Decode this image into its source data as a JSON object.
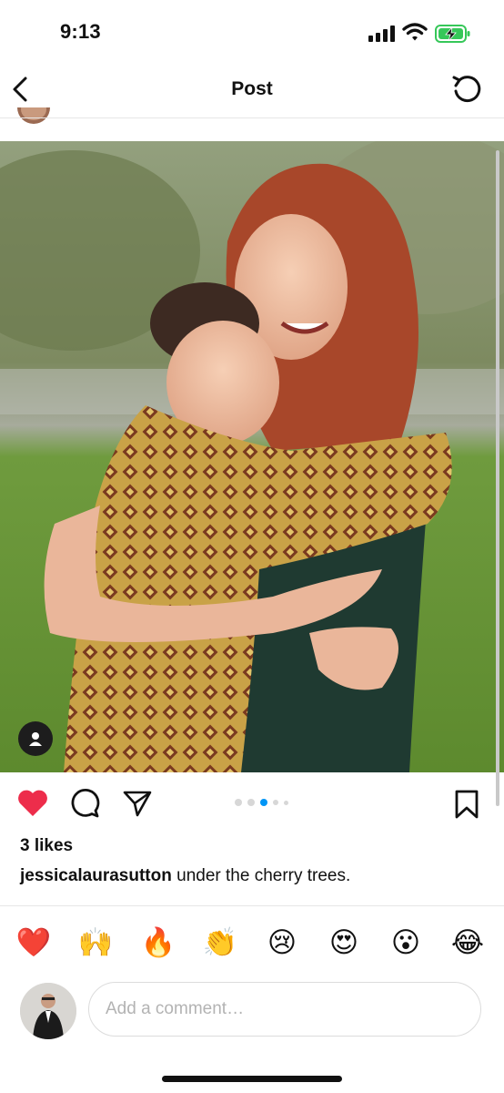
{
  "status": {
    "time": "9:13"
  },
  "header": {
    "title": "Post"
  },
  "post": {
    "likes": "3 likes",
    "username": "jessicalaurasutton",
    "caption": " under the cherry trees.",
    "carousel_total": 5,
    "carousel_active_index": 2
  },
  "reactions": [
    "❤️",
    "🙌",
    "🔥",
    "👏",
    "😢",
    "😍",
    "😮",
    "😂"
  ],
  "comment": {
    "placeholder": "Add a comment…"
  },
  "colors": {
    "heart": "#ed2d4b",
    "accent": "#0095f6",
    "battery": "#36c759"
  }
}
